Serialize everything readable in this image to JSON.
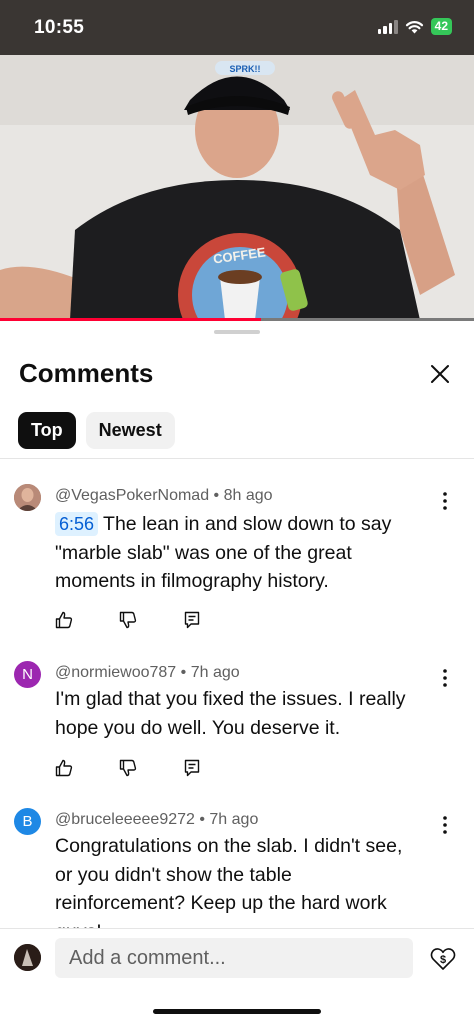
{
  "status_bar": {
    "time": "10:55",
    "battery": "42",
    "icons": [
      "signal-icon",
      "wifi-icon",
      "battery-icon"
    ]
  },
  "video": {
    "progress": 0.55,
    "shirt_text": "COFFEE",
    "hat_text": "SPRK!!"
  },
  "comments_panel": {
    "title": "Comments",
    "close_icon": "close-icon",
    "filters": [
      {
        "label": "Top",
        "active": true
      },
      {
        "label": "Newest",
        "active": false
      }
    ]
  },
  "comments": [
    {
      "author": "@VegasPokerNomad",
      "separator": " • ",
      "time": "8h ago",
      "timestamp_link": "6:56",
      "text": "The lean in and slow down to say \"marble slab\" was one of the great moments in filmography history.",
      "avatar_initial": "",
      "avatar_color": "#9c6b5b"
    },
    {
      "author": "@normiewoo787",
      "separator": " • ",
      "time": "7h ago",
      "timestamp_link": "",
      "text": "I'm glad that you fixed the issues.  I really hope you do well.  You deserve it.",
      "avatar_initial": "N",
      "avatar_color": "#9c27b0"
    },
    {
      "author": "@bruceleeeee9272",
      "separator": " • ",
      "time": "7h ago",
      "timestamp_link": "",
      "text": "Congratulations on the slab. I didn't see, or you didn't show the table reinforcement? Keep up the hard work guys!",
      "avatar_initial": "B",
      "avatar_color": "#1e88e5"
    }
  ],
  "action_icons": [
    "like-icon",
    "dislike-icon",
    "reply-icon"
  ],
  "add_comment": {
    "placeholder": "Add a comment...",
    "thanks_icon": "super-thanks-icon"
  },
  "colors": {
    "accent_red": "#ff0033",
    "link_blue": "#065fd4",
    "chip_active": "#0f0f0f",
    "battery_green": "#35c759"
  }
}
